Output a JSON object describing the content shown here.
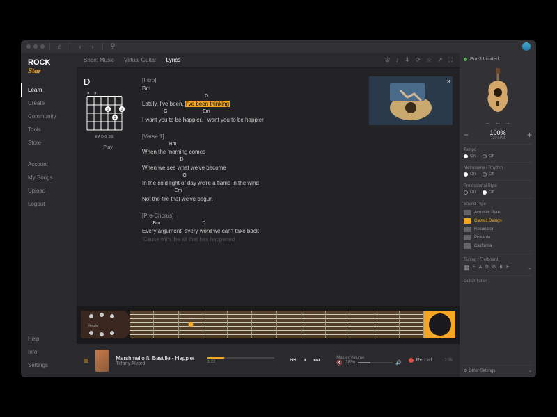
{
  "logo": {
    "line1": "ROCK",
    "line2": "Star"
  },
  "sidebar": {
    "main": [
      {
        "label": "Learn",
        "active": true
      },
      {
        "label": "Create"
      },
      {
        "label": "Community"
      },
      {
        "label": "Tools"
      },
      {
        "label": "Store"
      }
    ],
    "account": [
      {
        "label": "Account"
      },
      {
        "label": "My Songs"
      },
      {
        "label": "Upload"
      },
      {
        "label": "Logout"
      }
    ],
    "bottom": [
      {
        "label": "Help"
      },
      {
        "label": "Info"
      },
      {
        "label": "Settings"
      }
    ]
  },
  "tabs": [
    {
      "label": "Sheet Music"
    },
    {
      "label": "Virtual Guitar"
    },
    {
      "label": "Lyrics",
      "active": true
    }
  ],
  "chord": {
    "name": "D",
    "play": "Play",
    "strings": "E A D G B E"
  },
  "lyrics": {
    "intro_label": "[Intro]",
    "intro_chord": "Bm",
    "l1_chord": "D",
    "l1a": "Lately, I've been,",
    "l1b": "I've been thinking",
    "l2_chords": "                G                          Em",
    "l2": "I want you to be happier, I want you to be happier",
    "verse_label": "[Verse 1]",
    "v1_chord": "                    Bm",
    "v1": "When the morning comes",
    "v2_chord": "                            D",
    "v2": "When we see what we've become",
    "v3_chord": "                              G",
    "v3": "In the cold light of day we're a flame in the wind",
    "v4_chord": "                        Em",
    "v4": "Not the fire that we've begun",
    "pre_label": "[Pre-Chorus]",
    "p1_chord": "        Bm                               D",
    "p1": "Every argument, every word we can't take back",
    "faded": "'Cause with the all that has happened"
  },
  "player": {
    "title": "Marshmello ft. Bastille - Happier",
    "artist": "Tiffany Alvord",
    "elapsed": "1:22",
    "total": "2:35",
    "volume_label": "Master Volume",
    "volume_pct": "18%",
    "record": "Record"
  },
  "right": {
    "plan": "Pm-3 Limited",
    "zoom": "100%",
    "zoom_sub": "123 BPM",
    "tempo_label": "Tempo",
    "metronome_label": "Metronome / Rhythm",
    "style_label": "Professional Style",
    "on": "On",
    "off": "Off",
    "sound_label": "Sound Type",
    "sounds": [
      {
        "name": "Acoustic Pure"
      },
      {
        "name": "Classic Design",
        "active": true
      },
      {
        "name": "Resonator"
      },
      {
        "name": "Pickardo"
      },
      {
        "name": "California"
      }
    ],
    "tuning_label": "Tuning / Fretboard",
    "tuning": "E A D G B E",
    "tuner_label": "Guitar Tuner",
    "other": "Other Settings"
  }
}
